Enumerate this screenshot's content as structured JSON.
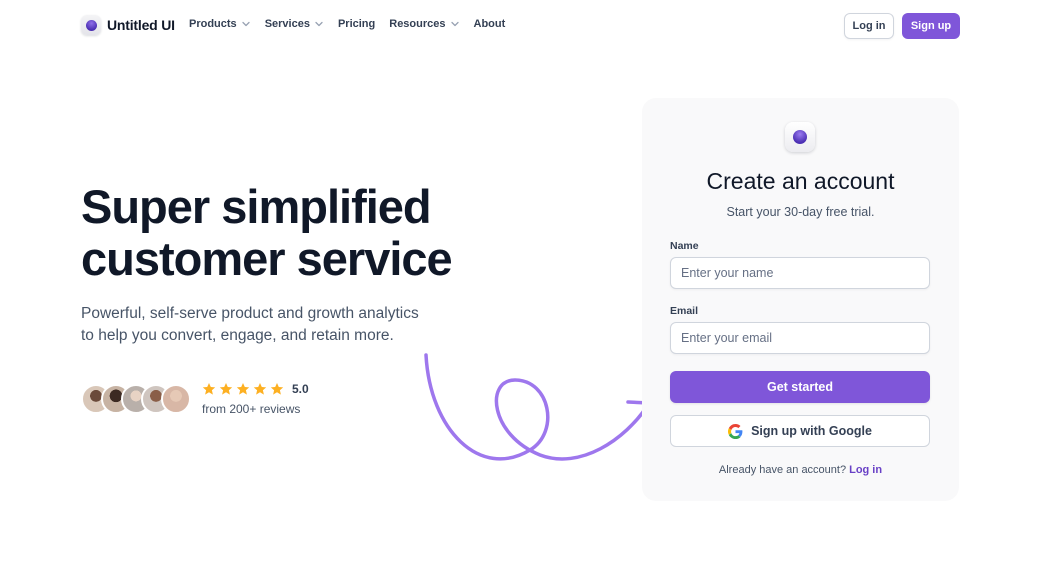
{
  "brand": {
    "name": "Untitled UI"
  },
  "nav": {
    "items": [
      {
        "label": "Products",
        "dropdown": true
      },
      {
        "label": "Services",
        "dropdown": true
      },
      {
        "label": "Pricing",
        "dropdown": false
      },
      {
        "label": "Resources",
        "dropdown": true
      },
      {
        "label": "About",
        "dropdown": false
      }
    ],
    "login_label": "Log in",
    "signup_label": "Sign up"
  },
  "hero": {
    "title_line1": "Super simplified",
    "title_line2": "customer service",
    "subtitle_line1": "Powerful, self-serve product and growth analytics",
    "subtitle_line2": "to help you convert, engage, and retain more.",
    "rating": "5.0",
    "stars": 5,
    "reviews": "from 200+ reviews"
  },
  "signup_card": {
    "title": "Create an account",
    "subtitle": "Start your 30-day free trial.",
    "name_label": "Name",
    "name_placeholder": "Enter your name",
    "email_label": "Email",
    "email_placeholder": "Enter your email",
    "submit_label": "Get started",
    "google_label": "Sign up with Google",
    "footer_text": "Already have an account?",
    "footer_link": "Log in"
  },
  "colors": {
    "accent": "#7f56d9",
    "star": "#fdb022",
    "swirl": "#9e77ed"
  }
}
